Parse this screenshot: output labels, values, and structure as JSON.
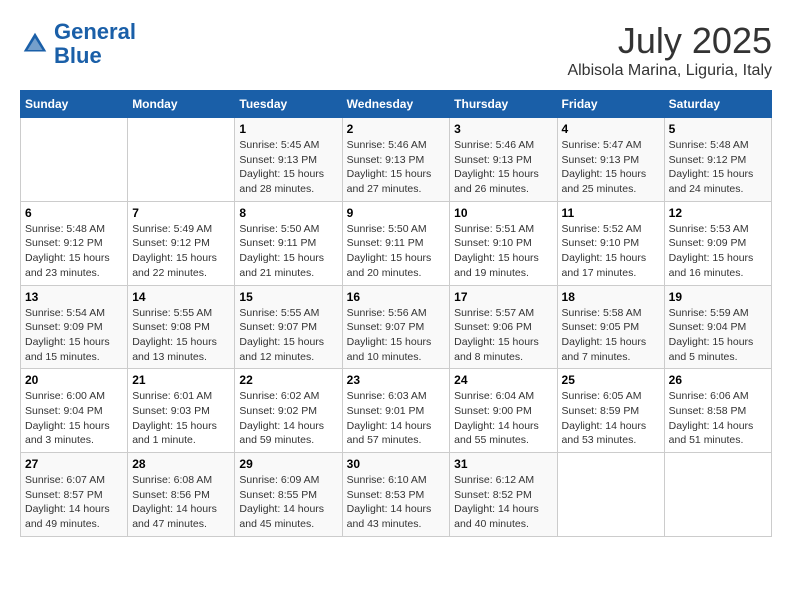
{
  "header": {
    "logo_line1": "General",
    "logo_line2": "Blue",
    "month": "July 2025",
    "location": "Albisola Marina, Liguria, Italy"
  },
  "weekdays": [
    "Sunday",
    "Monday",
    "Tuesday",
    "Wednesday",
    "Thursday",
    "Friday",
    "Saturday"
  ],
  "weeks": [
    [
      {
        "day": "",
        "info": ""
      },
      {
        "day": "",
        "info": ""
      },
      {
        "day": "1",
        "info": "Sunrise: 5:45 AM\nSunset: 9:13 PM\nDaylight: 15 hours\nand 28 minutes."
      },
      {
        "day": "2",
        "info": "Sunrise: 5:46 AM\nSunset: 9:13 PM\nDaylight: 15 hours\nand 27 minutes."
      },
      {
        "day": "3",
        "info": "Sunrise: 5:46 AM\nSunset: 9:13 PM\nDaylight: 15 hours\nand 26 minutes."
      },
      {
        "day": "4",
        "info": "Sunrise: 5:47 AM\nSunset: 9:13 PM\nDaylight: 15 hours\nand 25 minutes."
      },
      {
        "day": "5",
        "info": "Sunrise: 5:48 AM\nSunset: 9:12 PM\nDaylight: 15 hours\nand 24 minutes."
      }
    ],
    [
      {
        "day": "6",
        "info": "Sunrise: 5:48 AM\nSunset: 9:12 PM\nDaylight: 15 hours\nand 23 minutes."
      },
      {
        "day": "7",
        "info": "Sunrise: 5:49 AM\nSunset: 9:12 PM\nDaylight: 15 hours\nand 22 minutes."
      },
      {
        "day": "8",
        "info": "Sunrise: 5:50 AM\nSunset: 9:11 PM\nDaylight: 15 hours\nand 21 minutes."
      },
      {
        "day": "9",
        "info": "Sunrise: 5:50 AM\nSunset: 9:11 PM\nDaylight: 15 hours\nand 20 minutes."
      },
      {
        "day": "10",
        "info": "Sunrise: 5:51 AM\nSunset: 9:10 PM\nDaylight: 15 hours\nand 19 minutes."
      },
      {
        "day": "11",
        "info": "Sunrise: 5:52 AM\nSunset: 9:10 PM\nDaylight: 15 hours\nand 17 minutes."
      },
      {
        "day": "12",
        "info": "Sunrise: 5:53 AM\nSunset: 9:09 PM\nDaylight: 15 hours\nand 16 minutes."
      }
    ],
    [
      {
        "day": "13",
        "info": "Sunrise: 5:54 AM\nSunset: 9:09 PM\nDaylight: 15 hours\nand 15 minutes."
      },
      {
        "day": "14",
        "info": "Sunrise: 5:55 AM\nSunset: 9:08 PM\nDaylight: 15 hours\nand 13 minutes."
      },
      {
        "day": "15",
        "info": "Sunrise: 5:55 AM\nSunset: 9:07 PM\nDaylight: 15 hours\nand 12 minutes."
      },
      {
        "day": "16",
        "info": "Sunrise: 5:56 AM\nSunset: 9:07 PM\nDaylight: 15 hours\nand 10 minutes."
      },
      {
        "day": "17",
        "info": "Sunrise: 5:57 AM\nSunset: 9:06 PM\nDaylight: 15 hours\nand 8 minutes."
      },
      {
        "day": "18",
        "info": "Sunrise: 5:58 AM\nSunset: 9:05 PM\nDaylight: 15 hours\nand 7 minutes."
      },
      {
        "day": "19",
        "info": "Sunrise: 5:59 AM\nSunset: 9:04 PM\nDaylight: 15 hours\nand 5 minutes."
      }
    ],
    [
      {
        "day": "20",
        "info": "Sunrise: 6:00 AM\nSunset: 9:04 PM\nDaylight: 15 hours\nand 3 minutes."
      },
      {
        "day": "21",
        "info": "Sunrise: 6:01 AM\nSunset: 9:03 PM\nDaylight: 15 hours\nand 1 minute."
      },
      {
        "day": "22",
        "info": "Sunrise: 6:02 AM\nSunset: 9:02 PM\nDaylight: 14 hours\nand 59 minutes."
      },
      {
        "day": "23",
        "info": "Sunrise: 6:03 AM\nSunset: 9:01 PM\nDaylight: 14 hours\nand 57 minutes."
      },
      {
        "day": "24",
        "info": "Sunrise: 6:04 AM\nSunset: 9:00 PM\nDaylight: 14 hours\nand 55 minutes."
      },
      {
        "day": "25",
        "info": "Sunrise: 6:05 AM\nSunset: 8:59 PM\nDaylight: 14 hours\nand 53 minutes."
      },
      {
        "day": "26",
        "info": "Sunrise: 6:06 AM\nSunset: 8:58 PM\nDaylight: 14 hours\nand 51 minutes."
      }
    ],
    [
      {
        "day": "27",
        "info": "Sunrise: 6:07 AM\nSunset: 8:57 PM\nDaylight: 14 hours\nand 49 minutes."
      },
      {
        "day": "28",
        "info": "Sunrise: 6:08 AM\nSunset: 8:56 PM\nDaylight: 14 hours\nand 47 minutes."
      },
      {
        "day": "29",
        "info": "Sunrise: 6:09 AM\nSunset: 8:55 PM\nDaylight: 14 hours\nand 45 minutes."
      },
      {
        "day": "30",
        "info": "Sunrise: 6:10 AM\nSunset: 8:53 PM\nDaylight: 14 hours\nand 43 minutes."
      },
      {
        "day": "31",
        "info": "Sunrise: 6:12 AM\nSunset: 8:52 PM\nDaylight: 14 hours\nand 40 minutes."
      },
      {
        "day": "",
        "info": ""
      },
      {
        "day": "",
        "info": ""
      }
    ]
  ]
}
